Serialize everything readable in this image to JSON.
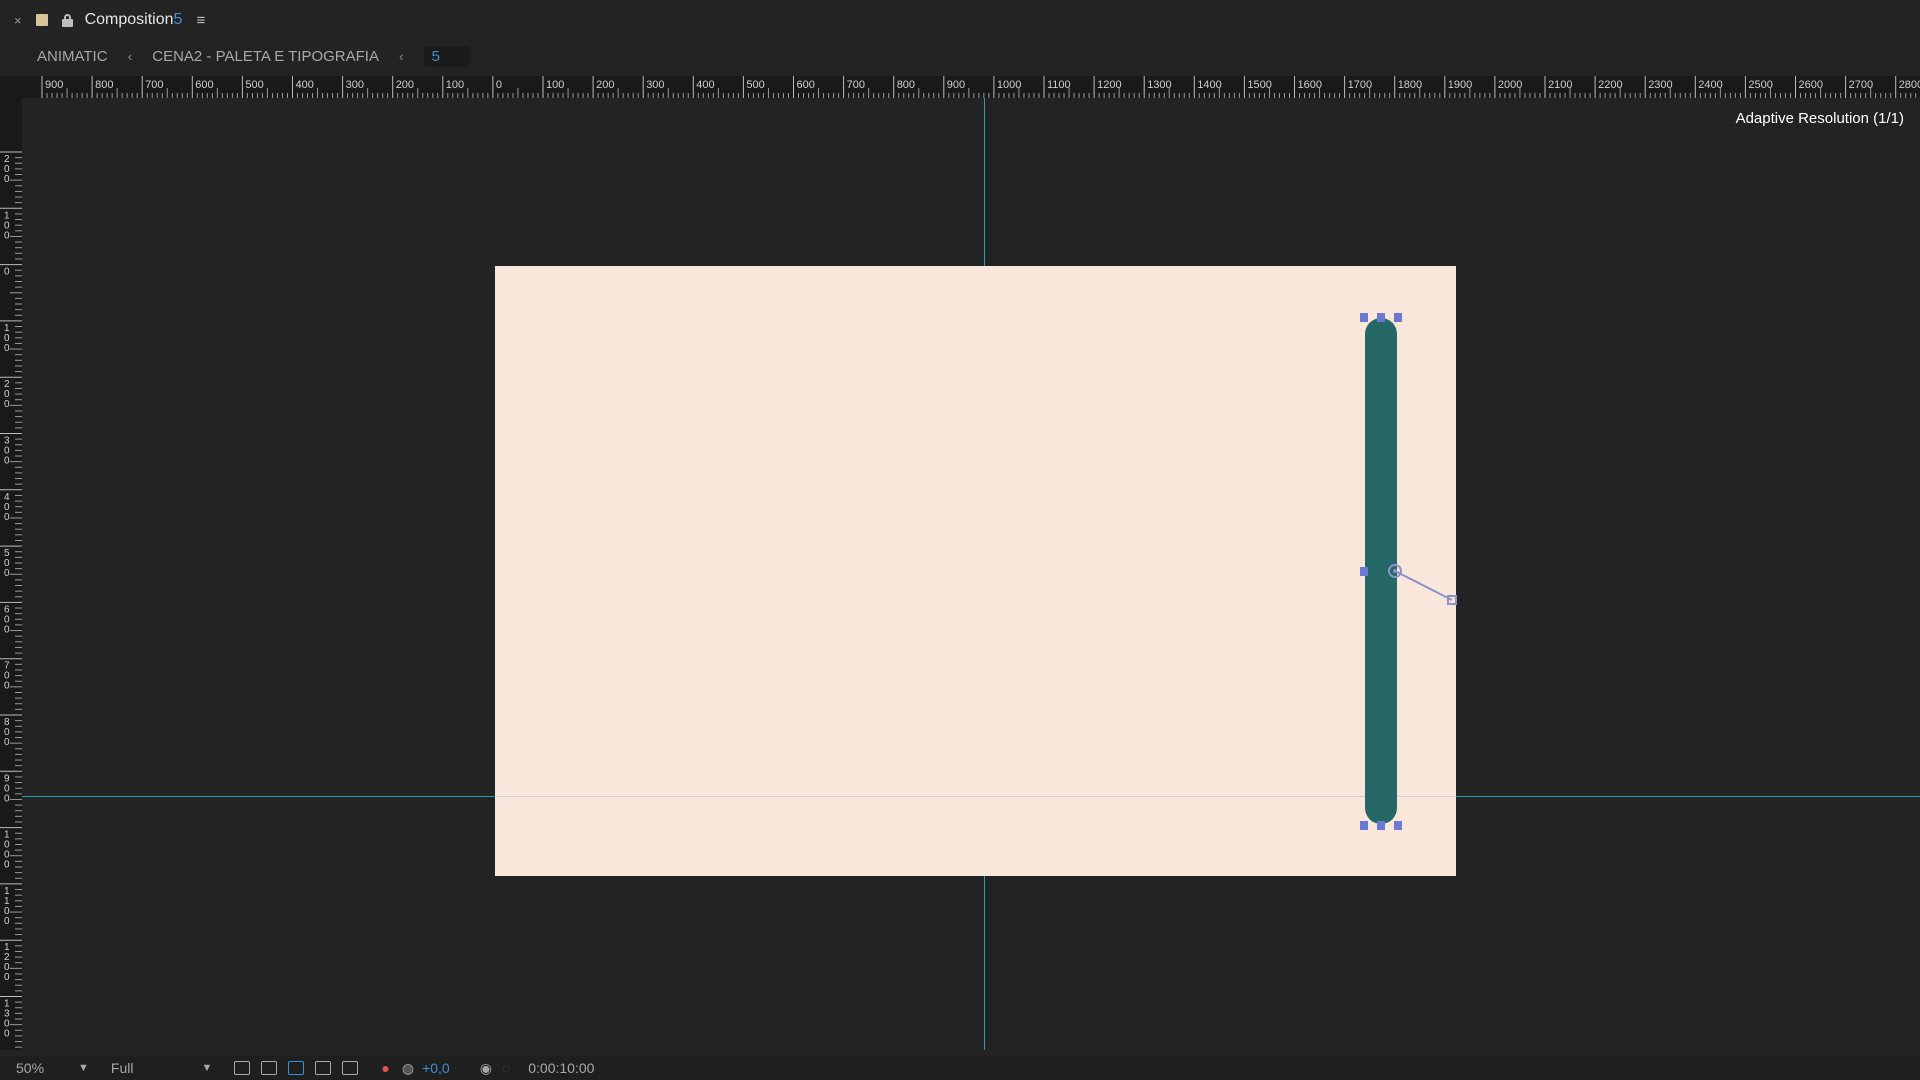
{
  "panel": {
    "close_label": "×",
    "title": "Composition",
    "title_number": "5",
    "menu_label": "≡"
  },
  "breadcrumb": {
    "items": [
      "ANIMATIC",
      "CENA2 - PALETA E TIPOGRAFIA"
    ],
    "current": "5",
    "separator": "‹"
  },
  "ruler": {
    "top_labels": [
      "900",
      "800",
      "700",
      "600",
      "500",
      "400",
      "300",
      "200",
      "100",
      "0",
      "100",
      "200",
      "300",
      "400",
      "500",
      "600",
      "700",
      "800",
      "900",
      "1000",
      "1100",
      "1200",
      "1300",
      "1400",
      "1500",
      "1600",
      "1700",
      "1800",
      "1900",
      "2000",
      "2100",
      "2200",
      "2300",
      "2400",
      "2500",
      "2600",
      "2700",
      "2800"
    ],
    "left_labels": [
      "200",
      "100",
      "0",
      "100",
      "200",
      "300",
      "400",
      "500",
      "600",
      "700",
      "800",
      "900",
      "1000",
      "1100",
      "1200",
      "1300"
    ]
  },
  "viewer": {
    "adaptive_resolution": "Adaptive Resolution (1/1)",
    "composition_bg_color": "#f9e7dc",
    "shape_color": "#266866",
    "guide_color": "#2a9bb0",
    "handle_color": "#6b78d6"
  },
  "statusbar": {
    "zoom": "50%",
    "resolution": "Full",
    "exposure": "+0,0",
    "timecode": "0:00:10:00",
    "icons": [
      "region-of-interest-icon",
      "transparency-grid-icon",
      "mask-visibility-icon",
      "title-safe-icon",
      "grid-icon",
      "color-channels-icon",
      "reset-exposure-icon",
      "snapshot-camera-icon",
      "show-snapshot-icon"
    ]
  }
}
